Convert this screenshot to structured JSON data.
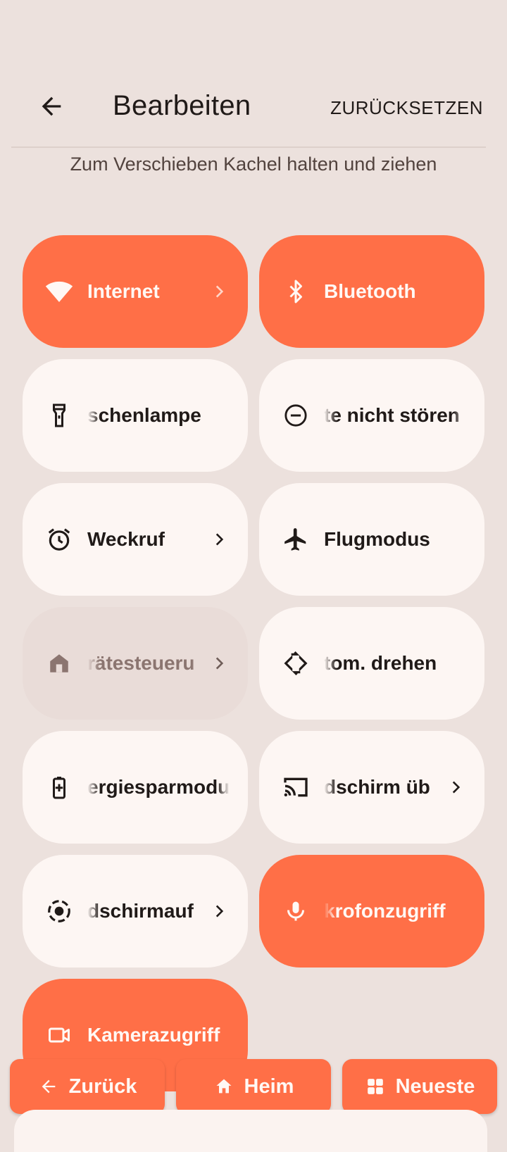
{
  "header": {
    "title": "Bearbeiten",
    "reset_label": "ZURÜCKSETZEN",
    "hint": "Zum Verschieben Kachel halten und ziehen"
  },
  "tiles": [
    {
      "label": "Internet",
      "icon": "wifi-icon",
      "state": "active",
      "chevron": true
    },
    {
      "label": "Bluetooth",
      "icon": "bluetooth-icon",
      "state": "active",
      "chevron": false
    },
    {
      "label": "schenlampe",
      "icon": "flashlight-icon",
      "state": "inactive",
      "chevron": false
    },
    {
      "label": "te nicht stören",
      "icon": "do-not-disturb-icon",
      "state": "inactive",
      "chevron": false
    },
    {
      "label": "Weckruf",
      "icon": "alarm-icon",
      "state": "inactive",
      "chevron": true
    },
    {
      "label": "Flugmodus",
      "icon": "airplane-icon",
      "state": "inactive",
      "chevron": false
    },
    {
      "label": "rätesteueru",
      "icon": "home-icon",
      "state": "disabled",
      "chevron": true
    },
    {
      "label": "tom. drehen",
      "icon": "auto-rotate-icon",
      "state": "inactive",
      "chevron": false
    },
    {
      "label": "ergiesparmodu",
      "icon": "battery-saver-icon",
      "state": "inactive",
      "chevron": false
    },
    {
      "label": "dschirm üb",
      "icon": "cast-icon",
      "state": "inactive",
      "chevron": true
    },
    {
      "label": "dschirmauf",
      "icon": "screen-record-icon",
      "state": "inactive",
      "chevron": true
    },
    {
      "label": "krofonzugriff",
      "icon": "microphone-icon",
      "state": "active",
      "chevron": false
    },
    {
      "label": "Kamerazugriff",
      "icon": "camera-icon",
      "state": "active",
      "chevron": false
    }
  ],
  "navbar": {
    "back_label": "Zurück",
    "home_label": "Heim",
    "recents_label": "Neueste"
  },
  "colors": {
    "background": "#ece1dd",
    "tile_active": "#ff6f47",
    "tile_inactive": "#fdf6f3",
    "tile_disabled": "#e9dcd8"
  }
}
